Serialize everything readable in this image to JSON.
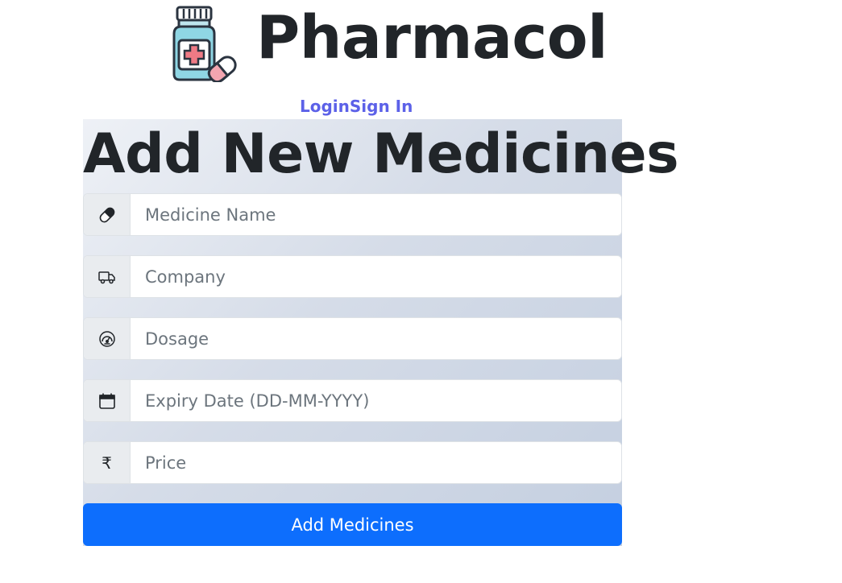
{
  "brand": {
    "name": "Pharmacol",
    "logo_icon": "medicine-bottle-icon"
  },
  "nav": {
    "login_label": "Login",
    "signin_label": "Sign In"
  },
  "form": {
    "title": "Add New Medicines",
    "fields": [
      {
        "icon": "capsule-icon",
        "placeholder": "Medicine Name"
      },
      {
        "icon": "truck-icon",
        "placeholder": "Company"
      },
      {
        "icon": "speedometer-icon",
        "placeholder": "Dosage"
      },
      {
        "icon": "calendar-icon",
        "placeholder": "Expiry Date (DD-MM-YYYY)"
      },
      {
        "icon": "rupee-icon",
        "symbol": "₹",
        "placeholder": "Price"
      }
    ],
    "submit_label": "Add Medicines"
  },
  "colors": {
    "link": "#5c61e8",
    "primary_button": "#0d6efd",
    "addon_bg": "#e9ecef"
  }
}
